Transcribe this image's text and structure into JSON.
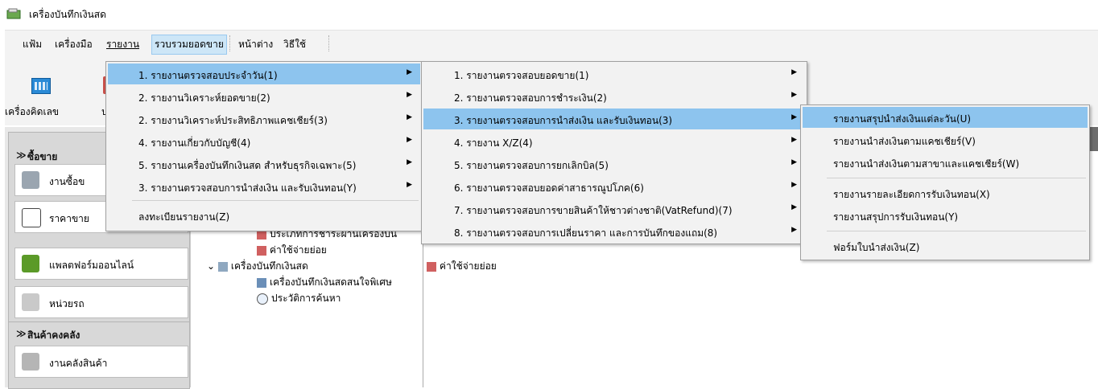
{
  "window": {
    "title": "เครื่องบันทึกเงินสด"
  },
  "menubar": {
    "items": [
      "แฟ้ม",
      "เครื่องมือ",
      "รายงาน",
      "รวบรวมยอดขาย",
      "หน้าต่าง",
      "วิธีใช้"
    ]
  },
  "toolbar": {
    "calculator_label": "เครื่องคิดเลข",
    "partial_label": "ป"
  },
  "leftnav": {
    "sales_header": "ซื้อขาย",
    "buttons": [
      "งานซื้อข",
      "ราคาขาย",
      "แพลตฟอร์มออนไลน์",
      "หน่วยรถ"
    ],
    "stock_header": "สินค้าคงคลัง",
    "stock_button": "งานคลังสินค้า"
  },
  "tree": {
    "rows": [
      "ประเภทการชำระผ่านเครื่องบัน",
      "ค่าใช้จ่ายย่อย",
      "เครื่องบันทึกเงินสด",
      "เครื่องบันทึกเงินสดสนใจพิเศษ",
      "ประวัติการค้นหา"
    ]
  },
  "rightpane": {
    "row1": "ค่าใช้จ่ายย่อย"
  },
  "menu1": {
    "items": [
      "1. รายงานตรวจสอบประจำวัน(1)",
      "2. รายงานวิเคราะห์ยอดขาย(2)",
      "2. รายงานวิเคราะห์ประสิทธิภาพแคชเชียร์(3)",
      "4. รายงานเกี่ยวกับบัญชี(4)",
      "5. รายงานเครื่องบันทึกเงินสด สำหรับธุรกิจเฉพาะ(5)",
      "3. รายงานตรวจสอบการนำส่งเงิน และรับเงินทอน(Y)",
      "ลงทะเบียนรายงาน(Z)"
    ]
  },
  "menu2": {
    "items": [
      "1. รายงานตรวจสอบยอดขาย(1)",
      "2. รายงานตรวจสอบการชำระเงิน(2)",
      "3. รายงานตรวจสอบการนำส่งเงิน และรับเงินทอน(3)",
      "4. รายงาน X/Z(4)",
      "5. รายงานตรวจสอบการยกเลิกบิล(5)",
      "6. รายงานตรวจสอบยอดค่าสาธารณูปโภค(6)",
      "7. รายงานตรวจสอบการขายสินค้าให้ชาวต่างชาติ(VatRefund)(7)",
      "8. รายงานตรวจสอบการเปลี่ยนราคา และการบันทึกของแถม(8)"
    ]
  },
  "menu3": {
    "items": [
      "รายงานสรุปนำส่งเงินแต่ละวัน(U)",
      "รายงานนำส่งเงินตามแคชเชียร์(V)",
      "รายงานนำส่งเงินตามสาขาและแคชเชียร์(W)",
      "รายงานรายละเอียดการรับเงินทอน(X)",
      "รายงานสรุปการรับเงินทอน(Y)",
      "ฟอร์มใบนำส่งเงิน(Z)"
    ]
  }
}
